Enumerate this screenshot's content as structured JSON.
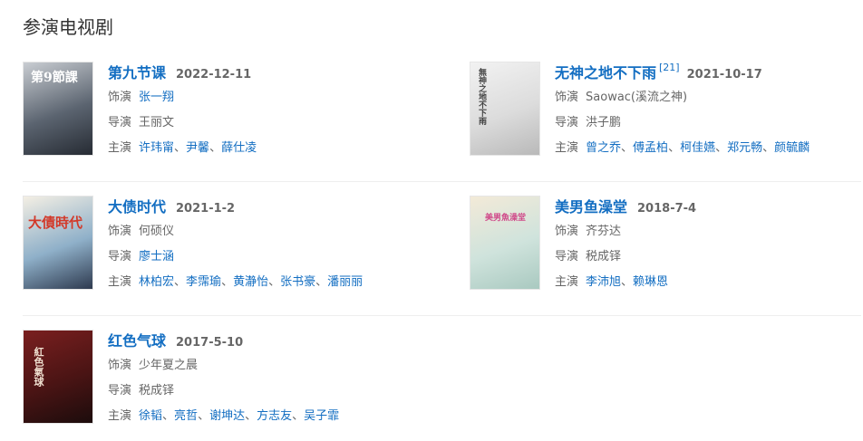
{
  "section_title": "参演电视剧",
  "labels": {
    "role": "饰演",
    "director": "导演",
    "cast": "主演"
  },
  "cards": [
    {
      "title": "第九节课",
      "ref": "",
      "date": "2022-12-11",
      "role": "张一翔",
      "role_link": true,
      "director": "王丽文",
      "director_link": false,
      "cast": [
        "许玮甯",
        "尹馨",
        "薛仕凌"
      ],
      "poster_text": "第9節課",
      "poster_colors": [
        "#c9cdd2",
        "#5b6470",
        "#262b33"
      ]
    },
    {
      "title": "无神之地不下雨",
      "ref": "[21]",
      "date": "2021-10-17",
      "role": "Saowac(溪流之神)",
      "role_link": false,
      "director": "洪子鹏",
      "director_link": false,
      "cast": [
        "曾之乔",
        "傅孟柏",
        "柯佳嬿",
        "郑元畅",
        "颜毓麟"
      ],
      "poster_text": "無神之地不下雨",
      "poster_colors": [
        "#f2f2f2",
        "#dcdcdc",
        "#b9b9b9"
      ]
    },
    {
      "title": "大债时代",
      "ref": "",
      "date": "2021-1-2",
      "role": "何硕仪",
      "role_link": false,
      "director": "廖士涵",
      "director_link": true,
      "cast": [
        "林柏宏",
        "李霈瑜",
        "黄瀞怡",
        "张书豪",
        "潘丽丽"
      ],
      "poster_text": "大債時代",
      "poster_colors": [
        "#f4efe4",
        "#8fb0c9",
        "#2e3a4f"
      ]
    },
    {
      "title": "美男鱼澡堂",
      "ref": "",
      "date": "2018-7-4",
      "role": "齐芬达",
      "role_link": false,
      "director": "税成铎",
      "director_link": false,
      "cast": [
        "李沛旭",
        "赖琳恩"
      ],
      "poster_text": "美男魚澡堂",
      "poster_colors": [
        "#f3ead8",
        "#cfe3dc",
        "#a9c9c0"
      ]
    },
    {
      "title": "红色气球",
      "ref": "",
      "date": "2017-5-10",
      "role": "少年夏之晨",
      "role_link": false,
      "director": "税成铎",
      "director_link": false,
      "cast": [
        "徐韬",
        "亮哲",
        "谢坤达",
        "方志友",
        "吴子霏"
      ],
      "poster_text": "紅色氣球",
      "poster_colors": [
        "#7a1f1f",
        "#4a1414",
        "#1c0c0c"
      ]
    }
  ]
}
